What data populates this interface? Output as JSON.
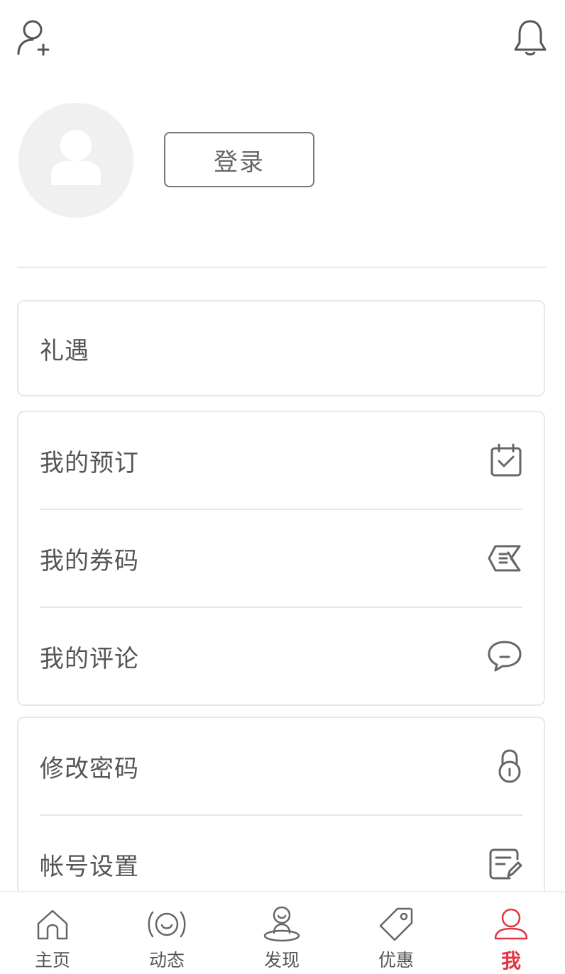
{
  "header": {
    "add_user_icon": "add-user-icon",
    "bell_icon": "bell-icon"
  },
  "profile": {
    "login_label": "登录"
  },
  "card_gift": {
    "items": [
      {
        "label": "礼遇"
      }
    ]
  },
  "card_mine": {
    "items": [
      {
        "label": "我的预订",
        "icon": "calendar-check-icon"
      },
      {
        "label": "我的券码",
        "icon": "coupon-icon"
      },
      {
        "label": "我的评论",
        "icon": "comment-icon"
      }
    ]
  },
  "card_settings": {
    "items": [
      {
        "label": "修改密码",
        "icon": "lock-icon"
      },
      {
        "label": "帐号设置",
        "icon": "edit-icon"
      }
    ]
  },
  "tabbar": {
    "active_color": "#e53340",
    "items": [
      {
        "label": "主页",
        "icon": "home-icon"
      },
      {
        "label": "动态",
        "icon": "feed-icon"
      },
      {
        "label": "发现",
        "icon": "discover-icon"
      },
      {
        "label": "优惠",
        "icon": "tag-icon"
      },
      {
        "label": "我",
        "icon": "person-icon",
        "active": true
      }
    ]
  }
}
